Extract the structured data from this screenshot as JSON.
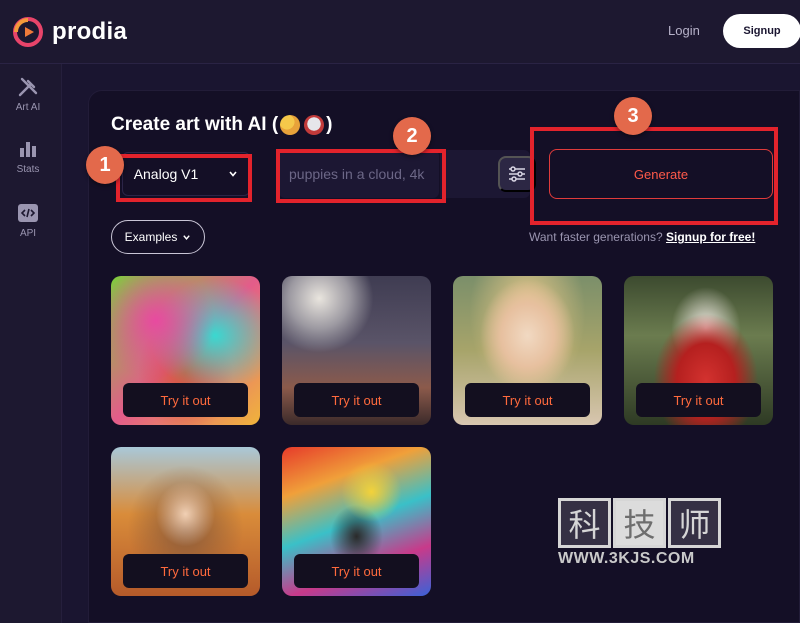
{
  "header": {
    "brand": "prodia",
    "login": "Login",
    "signup": "Signup"
  },
  "sidebar": {
    "items": [
      {
        "label": "Art AI",
        "icon": "brush-wand-icon"
      },
      {
        "label": "Stats",
        "icon": "bar-chart-icon"
      },
      {
        "label": "API",
        "icon": "code-icon"
      }
    ]
  },
  "main": {
    "title": "Create art with AI (",
    "title_close": ")",
    "model_select": "Analog V1",
    "prompt_placeholder": "puppies in a cloud, 4k",
    "generate": "Generate",
    "examples": "Examples",
    "faster_text": "Want faster generations?",
    "faster_link": "Signup for free!",
    "try_label": "Try it out",
    "cards": [
      "Try it out",
      "Try it out",
      "Try it out",
      "Try it out",
      "Try it out",
      "Try it out"
    ]
  },
  "annotations": [
    "1",
    "2",
    "3"
  ],
  "watermark": {
    "chars": [
      "科",
      "技",
      "师"
    ],
    "url": "WWW.3KJS.COM"
  },
  "colors": {
    "background": "#1a1530",
    "panel": "#140f26",
    "accent": "#ff5a4a",
    "annotation_red": "#e3232c",
    "annotation_badge": "#e3694b"
  }
}
